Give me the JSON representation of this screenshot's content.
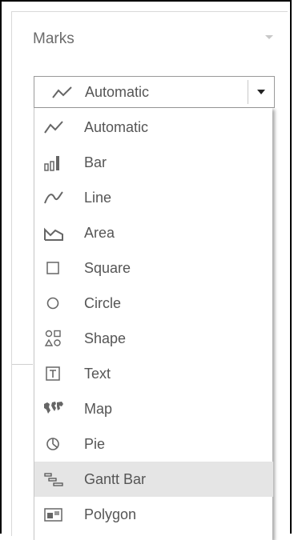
{
  "panel": {
    "title": "Marks"
  },
  "dropdown": {
    "selected_label": "Automatic",
    "icon": "automatic-line-icon"
  },
  "menu": {
    "items": [
      {
        "label": "Automatic",
        "icon": "automatic-line-icon"
      },
      {
        "label": "Bar",
        "icon": "bar-chart-icon"
      },
      {
        "label": "Line",
        "icon": "line-chart-icon"
      },
      {
        "label": "Area",
        "icon": "area-chart-icon"
      },
      {
        "label": "Square",
        "icon": "square-icon"
      },
      {
        "label": "Circle",
        "icon": "circle-icon"
      },
      {
        "label": "Shape",
        "icon": "shape-icon"
      },
      {
        "label": "Text",
        "icon": "text-icon"
      },
      {
        "label": "Map",
        "icon": "map-icon"
      },
      {
        "label": "Pie",
        "icon": "pie-icon"
      },
      {
        "label": "Gantt Bar",
        "icon": "gantt-bar-icon",
        "highlighted": true
      },
      {
        "label": "Polygon",
        "icon": "polygon-icon"
      }
    ]
  },
  "colors": {
    "highlight": "#e5e5e5",
    "text": "#555555",
    "icon": "#666666"
  }
}
